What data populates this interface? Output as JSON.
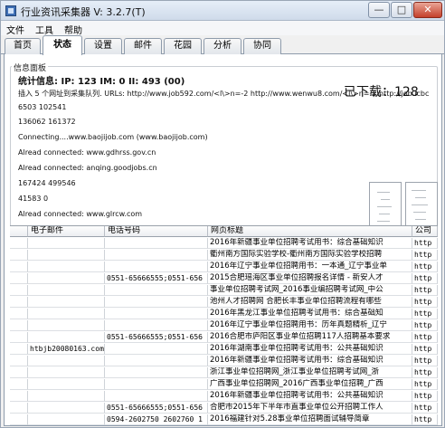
{
  "window": {
    "title": "行业资讯采集器 V: 3.2.7(T)",
    "controls": {
      "minimize": "—",
      "maximize": "□",
      "close": "✕"
    }
  },
  "menu": [
    "文件",
    "工具",
    "帮助"
  ],
  "tabs": [
    "首页",
    "状态",
    "设置",
    "邮件",
    "花园",
    "分析",
    "协同"
  ],
  "active_tab": "状态",
  "info_panel": {
    "legend": "信息面板",
    "stats_label": "统计信息:",
    "stats_values": "IP: 123 IM: 0 II: 493 (00)",
    "counter": "已下载：128",
    "log_lines": [
      "插入 5 个网址到采集队列. URLs: http://www.job592.com/<l\\>n=-2 http://www.wenwu8.com/<l\\>n=-2 http://job.icbc",
      "6503 102541",
      "136062 161372",
      "Connecting....www.baojijob.com (www.baojijob.com)",
      "Alread connected: www.gdhrss.gov.cn",
      "Alread connected: anqing.goodjobs.cn",
      "167424 499546",
      "41583 0",
      "Alread connected: www.glrcw.com"
    ]
  },
  "table": {
    "headers": [
      "",
      "电子邮件",
      "电话号码",
      "网页标题",
      "公司"
    ],
    "rows": [
      [
        "",
        "",
        "",
        "2016年新疆事业单位招聘考试用书：综合基础知识",
        "http"
      ],
      [
        "",
        "",
        "",
        "衢州南方国际实验学校-衢州南方国际实验学校招聘",
        "http"
      ],
      [
        "",
        "",
        "",
        "2016年辽宁事业单位招聘用书：一本通_辽宁事业单",
        "http"
      ],
      [
        "",
        "",
        "0551-65666555;0551-656",
        "2015合肥瑶海区事业单位招聘报名详情 - 新安人才",
        "http"
      ],
      [
        "",
        "",
        "",
        "事业单位招聘考试网_2016事业编招聘考试网_中公",
        "http"
      ],
      [
        "",
        "",
        "",
        "池州人才招聘网 合肥长丰事业单位招聘流程有哪些",
        "http"
      ],
      [
        "",
        "",
        "",
        "2016年黑龙江事业单位招聘考试用书：综合基础知",
        "http"
      ],
      [
        "",
        "",
        "",
        "2016年辽宁事业单位招聘用书：历年真题精析_辽宁",
        "http"
      ],
      [
        "",
        "",
        "0551-65666555;0551-656",
        "2016合肥市庐阳区事业单位招聘117人招聘基本要求",
        "http"
      ],
      [
        "",
        "htbjb20080163.com",
        "",
        "2016年湖南事业单位招聘考试用书：公共基础知识",
        "http"
      ],
      [
        "",
        "",
        "",
        "2016年新疆事业单位招聘考试用书：综合基础知识",
        "http"
      ],
      [
        "",
        "",
        "",
        "浙江事业单位招聘网_浙江事业单位招聘考试网_浙",
        "http"
      ],
      [
        "",
        "",
        "",
        "广西事业单位招聘网_2016广西事业单位招聘_广西",
        "http"
      ],
      [
        "",
        "",
        "",
        "2016年新疆事业单位招聘考试用书：公共基础知识",
        "http"
      ],
      [
        "",
        "",
        "0551-65666555;0551-656",
        "合肥市2015年下半年市直事业单位公开招聘工作人",
        "http"
      ],
      [
        "",
        "",
        "0594-2602750  2602760  1",
        "2016福建针对5.28事业单位招聘面试辅导简章",
        "http"
      ]
    ]
  }
}
